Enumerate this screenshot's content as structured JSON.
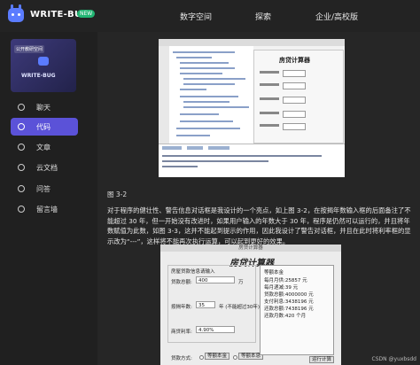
{
  "header": {
    "brand": "WRITE-BUG",
    "badge": "NEW",
    "nav": [
      "数字空间",
      "探索",
      "企业/高校版"
    ]
  },
  "sidebar": {
    "card_tag": "公开教研空间",
    "card_brand": "WRITE-BUG",
    "items": [
      {
        "label": "聊天",
        "icon": "chat-icon"
      },
      {
        "label": "代码",
        "icon": "code-icon",
        "active": true
      },
      {
        "label": "文章",
        "icon": "article-icon"
      },
      {
        "label": "云文档",
        "icon": "cloud-doc-icon"
      },
      {
        "label": "问答",
        "icon": "qa-icon"
      },
      {
        "label": "留言墙",
        "icon": "message-wall-icon"
      }
    ]
  },
  "article": {
    "caption": "图 3-2",
    "paragraph": "对于程序的健壮性、警告信息对话框是我设计的一个亮点，如上图 3-2，在按揭年数输入框的后面备注了不能超过 30 年，但一开始没有改进时，如果用户输入的年数大于 30 年，程序是仍然可以运行的，并且将年数赋值为此数，如图 3-3，这并不能起到提示的作用，因此我设计了警告对话框，并且在此时将利率框的显示改为“---”，这样将不能再次执行运算，可以起到更好的效果。"
  },
  "calculator": {
    "window_title": "房贷计算器",
    "heading": "房贷计算器",
    "group_title": "房屋贷款信息请输入",
    "loan_label": "贷款总额:",
    "loan_value": "400",
    "loan_unit": "万",
    "years_label": "按揭年数:",
    "years_value": "35",
    "years_note": "年 (不能超过30年)",
    "rate_label": "商贷利率:",
    "rate_value": "4.90%",
    "method_label": "贷款方式:",
    "method_options": [
      "等额本金",
      "等额本息"
    ],
    "calc_button": "运行计算",
    "result_title": "等额本金",
    "results": [
      {
        "label": "每月月供:",
        "value": "25857 元"
      },
      {
        "label": "每月递减:",
        "value": "39 元"
      },
      {
        "label": "贷款总额:",
        "value": "4000000 元"
      },
      {
        "label": "支付利息:",
        "value": "3438196 元"
      },
      {
        "label": "还款总额:",
        "value": "7438196 元"
      },
      {
        "label": "还款月数:",
        "value": "420 个月"
      }
    ]
  },
  "watermark": "CSDN @yuxbsdd"
}
